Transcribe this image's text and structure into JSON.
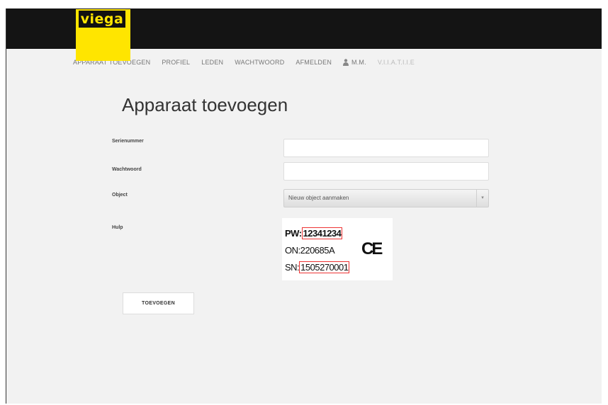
{
  "brand": {
    "logo_text": "viega"
  },
  "nav": {
    "items": [
      "APPARAAT TOEVOEGEN",
      "PROFIEL",
      "LEDEN",
      "WACHTWOORD",
      "AFMELDEN"
    ],
    "user": "M.M.",
    "extra": "V.I.I.A.T.I.I.E"
  },
  "page": {
    "title": "Apparaat toevoegen"
  },
  "form": {
    "serial_label": "Serienummer",
    "serial_value": "",
    "password_label": "Wachtwoord",
    "password_value": "",
    "object_label": "Object",
    "object_selected": "Nieuw object aanmaken",
    "help_label": "Hulp",
    "help_image": {
      "pw_prefix": "PW:",
      "pw_value": "12341234",
      "on_line": "ON:220685A",
      "sn_prefix": "SN:",
      "sn_value": "1505270001",
      "ce_mark": "CE"
    },
    "submit_label": "TOEVOEGEN"
  },
  "colors": {
    "brand_yellow": "#ffe500",
    "topbar": "#141414",
    "highlight_red": "#e33333"
  }
}
